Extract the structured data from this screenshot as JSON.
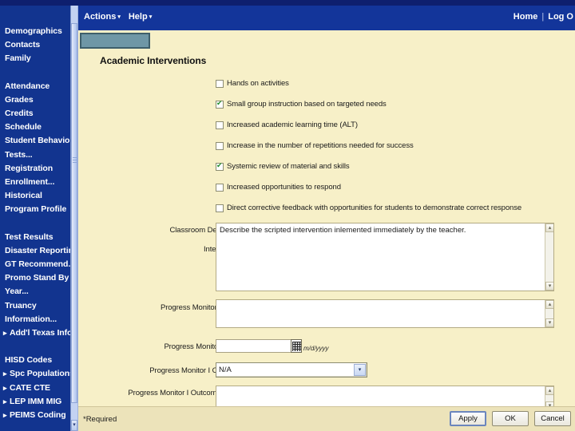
{
  "window": {
    "app_background": "#12288c"
  },
  "sidebar": {
    "groups": [
      {
        "items": [
          {
            "label": "Demographics",
            "arrow": false
          },
          {
            "label": "Contacts",
            "arrow": false
          },
          {
            "label": "Family",
            "arrow": false
          }
        ]
      },
      {
        "items": [
          {
            "label": "Attendance",
            "arrow": false
          },
          {
            "label": "Grades",
            "arrow": false
          },
          {
            "label": "Credits",
            "arrow": false
          },
          {
            "label": "Schedule",
            "arrow": false
          },
          {
            "label": "Student Behavior",
            "arrow": false
          },
          {
            "label": "Tests...",
            "arrow": false
          },
          {
            "label": "Registration",
            "arrow": false
          },
          {
            "label": "Enrollment...",
            "arrow": false
          },
          {
            "label": "Historical",
            "arrow": false
          },
          {
            "label": "Program Profile",
            "arrow": false
          }
        ]
      },
      {
        "items": [
          {
            "label": "Test Results",
            "arrow": false
          },
          {
            "label": "Disaster Reporting...",
            "arrow": false
          },
          {
            "label": "GT Recommend...",
            "arrow": false
          },
          {
            "label": "Promo Stand By",
            "arrow": false
          },
          {
            "label": "Year...",
            "arrow": false
          },
          {
            "label": "Truancy",
            "arrow": false
          },
          {
            "label": "Information...",
            "arrow": false
          },
          {
            "label": "Add'l Texas Info",
            "arrow": true
          }
        ]
      },
      {
        "items": [
          {
            "label": "HISD Codes",
            "arrow": false
          },
          {
            "label": "Spc Populations",
            "arrow": true
          },
          {
            "label": "CATE CTE",
            "arrow": true
          },
          {
            "label": "LEP IMM MIG",
            "arrow": true
          },
          {
            "label": "PEIMS Coding",
            "arrow": true
          }
        ]
      }
    ]
  },
  "menubar": {
    "actions_label": "Actions",
    "help_label": "Help",
    "caret": "▾",
    "home_label": "Home",
    "separator": "|",
    "logout_label": "Log O"
  },
  "page": {
    "title": "Academic Interventions",
    "tab_redacted_label": ""
  },
  "checkboxes": [
    {
      "label": "Hands on activities",
      "checked": false
    },
    {
      "label": "Small group instruction based on targeted needs",
      "checked": true
    },
    {
      "label": "Increased academic learning time (ALT)",
      "checked": false
    },
    {
      "label": "Increase in the number of repetitions needed for success",
      "checked": false
    },
    {
      "label": "Systemic review of material and skills",
      "checked": true
    },
    {
      "label": "Increased opportunities to respond",
      "checked": false
    },
    {
      "label": "Direct corrective feedback with opportunities for students to demonstrate correct response",
      "checked": false
    }
  ],
  "fields": {
    "classroom_description": {
      "label_line1": "Classroom Description of",
      "label_line2": "Intervention:",
      "value": "Describe the scripted intervention inlemented immediately by the teacher."
    },
    "progress_monitoring_tool": {
      "label": "Progress Monitoring Tool:",
      "value": ""
    },
    "progress_monitor_date": {
      "label": "Progress Monitor I Date:",
      "value": "",
      "format_hint": "m/d/yyyy",
      "calendar_icon": "calendar-icon"
    },
    "progress_monitor_outcome": {
      "label": "Progress Monitor I Outcome:",
      "selected": "N/A",
      "caret": "▾"
    },
    "progress_monitor_outcome_notes": {
      "label": "Progress Monitor I Outcome Notes:",
      "value": ""
    }
  },
  "footer": {
    "required_note": "*Required",
    "buttons": [
      {
        "label": "Apply",
        "primary": true
      },
      {
        "label": "OK",
        "primary": false
      },
      {
        "label": "Cancel",
        "primary": false
      }
    ]
  },
  "scroll": {
    "down_arrow": "▾",
    "up_arrow": "▴"
  }
}
